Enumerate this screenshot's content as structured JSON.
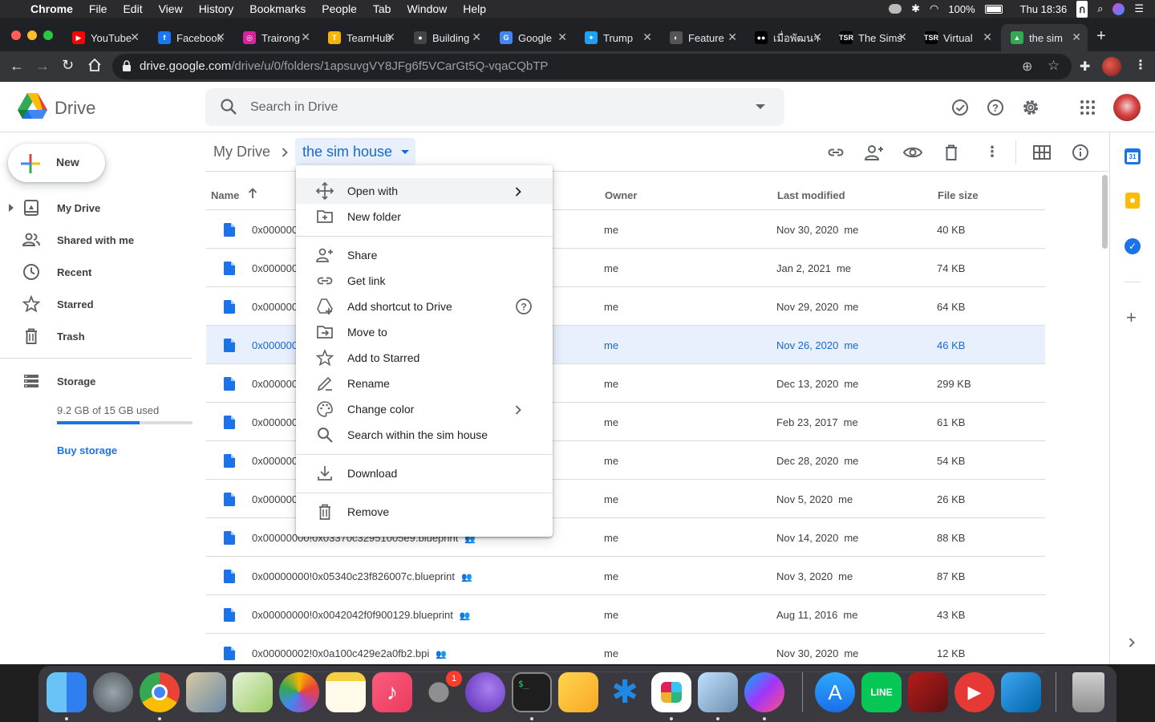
{
  "menubar": {
    "app_name": "Chrome",
    "items": [
      "File",
      "Edit",
      "View",
      "History",
      "Bookmarks",
      "People",
      "Tab",
      "Window",
      "Help"
    ],
    "battery": "100%",
    "clock": "Thu 18:36"
  },
  "tabs": [
    {
      "title": "YouTube",
      "color": "#ff0000",
      "glyph": "▶"
    },
    {
      "title": "Facebook",
      "color": "#1877f2",
      "glyph": "f"
    },
    {
      "title": "Trairong",
      "color": "#d6249f",
      "glyph": "◎"
    },
    {
      "title": "TeamHub",
      "color": "#f4b400",
      "glyph": "T"
    },
    {
      "title": "Building",
      "color": "#444444",
      "glyph": "●"
    },
    {
      "title": "Google",
      "color": "#4285f4",
      "glyph": "G"
    },
    {
      "title": "Trump",
      "color": "#1da1f2",
      "glyph": "✦"
    },
    {
      "title": "Feature",
      "color": "#555555",
      "glyph": "◐"
    },
    {
      "title": "เมื่อพัฒนา",
      "color": "#000000",
      "glyph": "●●"
    },
    {
      "title": "The Sims",
      "color": "#000000",
      "glyph": "TSR"
    },
    {
      "title": "Virtual",
      "color": "#000000",
      "glyph": "TSR"
    },
    {
      "title": "the sim",
      "color": "#34a853",
      "glyph": "▲"
    }
  ],
  "address": {
    "domain": "drive.google.com",
    "path": "/drive/u/0/folders/1apsuvgVY8JFg6f5VCarGt5Q-vqaCQbTP"
  },
  "drive": {
    "logo_text": "Drive",
    "search_placeholder": "Search in Drive",
    "new_label": "New",
    "nav": [
      {
        "label": "My Drive",
        "icon": "my-drive-icon"
      },
      {
        "label": "Shared with me",
        "icon": "shared-icon"
      },
      {
        "label": "Recent",
        "icon": "clock-icon"
      },
      {
        "label": "Starred",
        "icon": "star-icon"
      },
      {
        "label": "Trash",
        "icon": "trash-icon"
      }
    ],
    "storage_label": "Storage",
    "storage_used": "9.2 GB of 15 GB used",
    "storage_fraction": 0.61,
    "buy_storage": "Buy storage",
    "breadcrumb_root": "My Drive",
    "breadcrumb_current": "the sim house",
    "columns": {
      "name": "Name",
      "owner": "Owner",
      "modified": "Last modified",
      "size": "File size"
    },
    "files": [
      {
        "name": "0x000000",
        "owner": "me",
        "date": "Nov 30, 2020",
        "by": "me",
        "size": "40 KB"
      },
      {
        "name": "0x000000",
        "owner": "me",
        "date": "Jan 2, 2021",
        "by": "me",
        "size": "74 KB"
      },
      {
        "name": "0x000000",
        "owner": "me",
        "date": "Nov 29, 2020",
        "by": "me",
        "size": "64 KB"
      },
      {
        "name": "0x000000",
        "owner": "me",
        "date": "Nov 26, 2020",
        "by": "me",
        "size": "46 KB"
      },
      {
        "name": "0x000000",
        "owner": "me",
        "date": "Dec 13, 2020",
        "by": "me",
        "size": "299 KB"
      },
      {
        "name": "0x000000",
        "owner": "me",
        "date": "Feb 23, 2017",
        "by": "me",
        "size": "61 KB"
      },
      {
        "name": "0x000000",
        "owner": "me",
        "date": "Dec 28, 2020",
        "by": "me",
        "size": "54 KB"
      },
      {
        "name": "0x000000",
        "owner": "me",
        "date": "Nov 5, 2020",
        "by": "me",
        "size": "26 KB"
      },
      {
        "name": "0x00000000!0x03370c32951005e9.blueprint",
        "owner": "me",
        "date": "Nov 14, 2020",
        "by": "me",
        "size": "88 KB"
      },
      {
        "name": "0x00000000!0x05340c23f826007c.blueprint",
        "owner": "me",
        "date": "Nov 3, 2020",
        "by": "me",
        "size": "87 KB"
      },
      {
        "name": "0x00000000!0x0042042f0f900129.blueprint",
        "owner": "me",
        "date": "Aug 11, 2016",
        "by": "me",
        "size": "43 KB"
      },
      {
        "name": "0x00000002!0x0a100c429e2a0fb2.bpi",
        "owner": "me",
        "date": "Nov 30, 2020",
        "by": "me",
        "size": "12 KB"
      }
    ]
  },
  "context_menu": [
    {
      "label": "Open with",
      "icon": "open-with-icon",
      "submenu": true
    },
    {
      "label": "New folder",
      "icon": "new-folder-icon"
    },
    {
      "label": "Share",
      "icon": "share-icon"
    },
    {
      "label": "Get link",
      "icon": "link-icon"
    },
    {
      "label": "Add shortcut to Drive",
      "icon": "add-shortcut-icon",
      "help": true
    },
    {
      "label": "Move to",
      "icon": "move-to-icon"
    },
    {
      "label": "Add to Starred",
      "icon": "star-icon"
    },
    {
      "label": "Rename",
      "icon": "rename-icon"
    },
    {
      "label": "Change color",
      "icon": "palette-icon",
      "submenu": true
    },
    {
      "label": "Search within the sim house",
      "icon": "search-icon"
    },
    {
      "label": "Download",
      "icon": "download-icon"
    },
    {
      "label": "Remove",
      "icon": "trash-icon"
    }
  ],
  "dock": {
    "calendar_badge": "1"
  }
}
